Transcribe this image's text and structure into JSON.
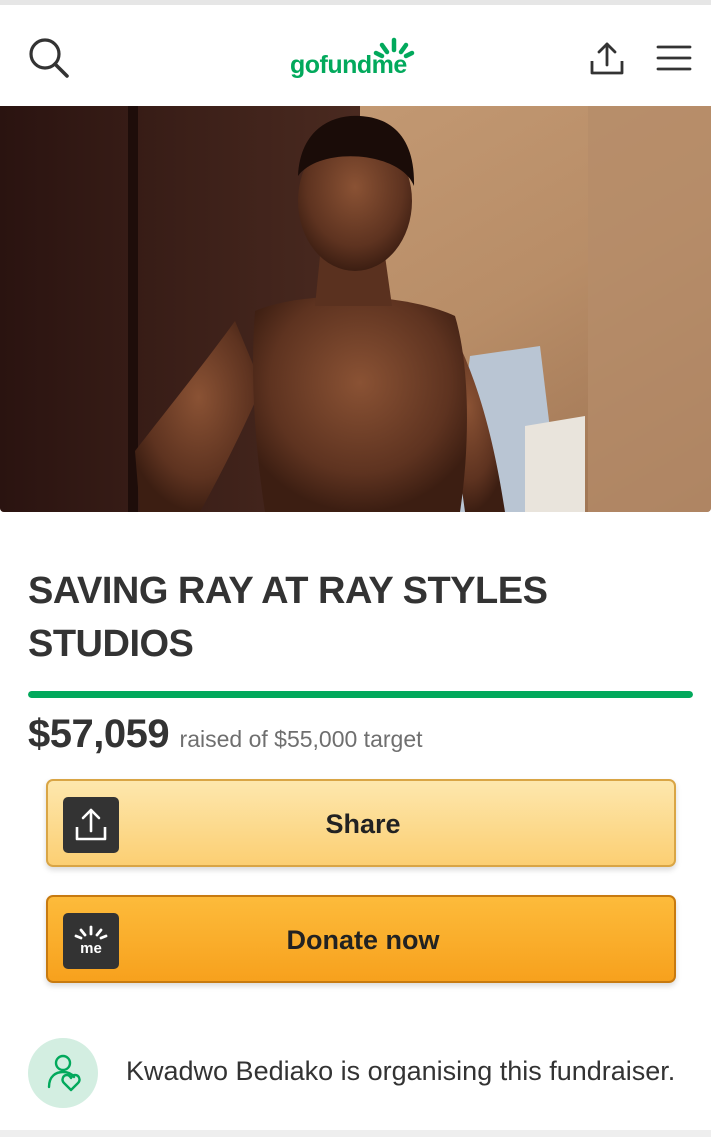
{
  "header": {
    "brand": "gofundme",
    "brand_color": "#02a95c",
    "icons": [
      "search-icon",
      "gofundme-logo",
      "share-icon",
      "menu-icon"
    ]
  },
  "hero": {
    "image_kind": "campaign-photo"
  },
  "campaign": {
    "title": "SAVING RAY AT RAY STYLES STUDIOS",
    "raised_amount": "$57,059",
    "raised_text": "raised of $55,000 target",
    "progress_fraction": 1.0
  },
  "actions": {
    "share_label": "Share",
    "donate_label": "Donate now",
    "donate_icon_text": "me",
    "share_color": "#fcd98a",
    "donate_color": "#fbad2c"
  },
  "organiser": {
    "text": "Kwadwo Bediako is organising this fundraiser."
  }
}
